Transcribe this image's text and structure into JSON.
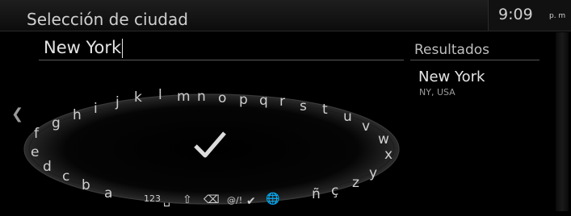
{
  "header": {
    "title": "Selección de ciudad",
    "time": "9:09",
    "time_suffix": "p. m"
  },
  "input": {
    "value": "New York"
  },
  "results": {
    "title": "Resultados",
    "items": [
      {
        "name": "New York",
        "subtitle": "NY, USA"
      }
    ]
  },
  "keyboard": {
    "letters": [
      "a",
      "b",
      "c",
      "d",
      "e",
      "f",
      "g",
      "h",
      "i",
      "j",
      "k",
      "l",
      "m",
      "n",
      "o",
      "p",
      "q",
      "r",
      "s",
      "t",
      "u",
      "v",
      "w",
      "x",
      "y",
      "z",
      "ç",
      "ñ"
    ],
    "numbers_label": "123",
    "symbols_label": "@/!"
  },
  "icons": {
    "back": "chevron-left-icon",
    "confirm": "checkmark-icon",
    "globe": "globe-icon",
    "space": "space-icon",
    "shift": "shift-icon",
    "backspace": "backspace-icon"
  }
}
